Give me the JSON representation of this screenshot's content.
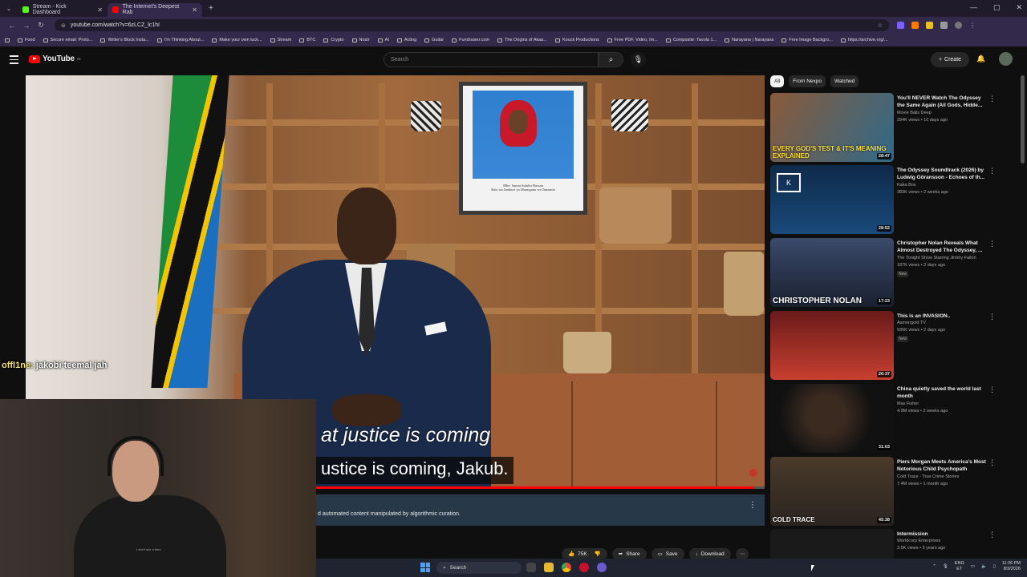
{
  "browser": {
    "tabs": [
      {
        "label": "Stream - Kick Dashboard",
        "active": false,
        "favicon_color": "#53fc18"
      },
      {
        "label": "The Internet's Deepest Rab",
        "active": true,
        "favicon_color": "#ff0000"
      }
    ],
    "url": "youtube.com/watch?v=6zLCZ_lc1hI",
    "bookmarks": [
      "Food",
      "Secure email: Proto...",
      "Writer's Block Insta...",
      "I'm Thinking About...",
      "Make your own luck...",
      "Stream",
      "BTC",
      "Crypto",
      "Nostr",
      "AI",
      "Acting",
      "Guitar",
      "Fundraiser.com",
      "The Origins of Akaa...",
      "Kouck Productions",
      "Free PDF, Video, Im...",
      "Composite: Tavola 1...",
      "Narayana | Narayana",
      "Free Image Backgro...",
      "https://archive.org/..."
    ]
  },
  "youtube": {
    "logo_text": "YouTube",
    "logo_region": "EE",
    "search_placeholder": "Search",
    "create_label": "Create"
  },
  "video": {
    "portrait_caption": "Mhe. Samia Suluhu Hassan",
    "portrait_subcaption": "Rais wa Jamhuri ya Muungano wa Tanzania",
    "subtitle_line1": "at justice is coming",
    "subtitle_line2": "ustice is coming, Jakub.",
    "info_text": "d automated content manipulated by algorithmic curation.",
    "progress_fraction": 0.985
  },
  "actions": {
    "likes": "75K",
    "share": "Share",
    "save": "Save",
    "download": "Download"
  },
  "overlay": {
    "chat_user": "offl1ne:",
    "chat_message": " jakobi teemal jah",
    "webcam_label": "I don't see a hero"
  },
  "sidebar": {
    "chips": [
      "All",
      "From Nexpo",
      "Watched"
    ],
    "videos": [
      {
        "title": "You'll NEVER Watch The Odyssey the Same Again (All Gods, Hidde...",
        "channel": "Movie Balls Deep",
        "meta": "294K views • 10 days ago",
        "duration": "28:47",
        "badge": "",
        "thumb_text": "EVERY GOD'S TEST & IT'S MEANING EXPLAINED"
      },
      {
        "title": "The Odyssey Soundtrack (2026) by Ludwig Göransson - Echoes of th...",
        "channel": "Kaka Box",
        "meta": "383K views • 2 weeks ago",
        "duration": "28:52",
        "badge": "",
        "thumb_text": ""
      },
      {
        "title": "Christopher Nolan Reveals What Almost Destroyed The Odyssey, ...",
        "channel": "The Tonight Show Starring Jimmy Fallon",
        "meta": "187K views • 2 days ago",
        "duration": "17:23",
        "badge": "New",
        "thumb_text": "CHRISTOPHER NOLAN"
      },
      {
        "title": "This is an INVASION..",
        "channel": "Asmongold TV",
        "meta": "936K views • 2 days ago",
        "duration": "26:37",
        "badge": "New",
        "thumb_text": ""
      },
      {
        "title": "China quietly saved the world last month",
        "channel": "Max Fisher",
        "meta": "4.9M views • 2 weeks ago",
        "duration": "31:03",
        "badge": "",
        "thumb_text": ""
      },
      {
        "title": "Piers Morgan Meets America's Most Notorious Child Psychopath",
        "channel": "Cold Trace - True Crime Stories",
        "meta": "7.4M views • 1 month ago",
        "duration": "45:38",
        "badge": "",
        "thumb_text": "COLD TRACE"
      },
      {
        "title": "Intermission",
        "channel": "Worldcorp Enterprises",
        "meta": "3.5K views • 5 years ago",
        "duration": "",
        "badge": "",
        "thumb_text": ""
      }
    ]
  },
  "taskbar": {
    "search_label": "Search",
    "lang_top": "ENG",
    "lang_bottom": "ET",
    "time": "11:26 PM",
    "date": "8/3/2026"
  },
  "colors": {
    "youtube_red": "#ff0000",
    "background": "#0f0f0f",
    "info_bar": "#273848"
  }
}
